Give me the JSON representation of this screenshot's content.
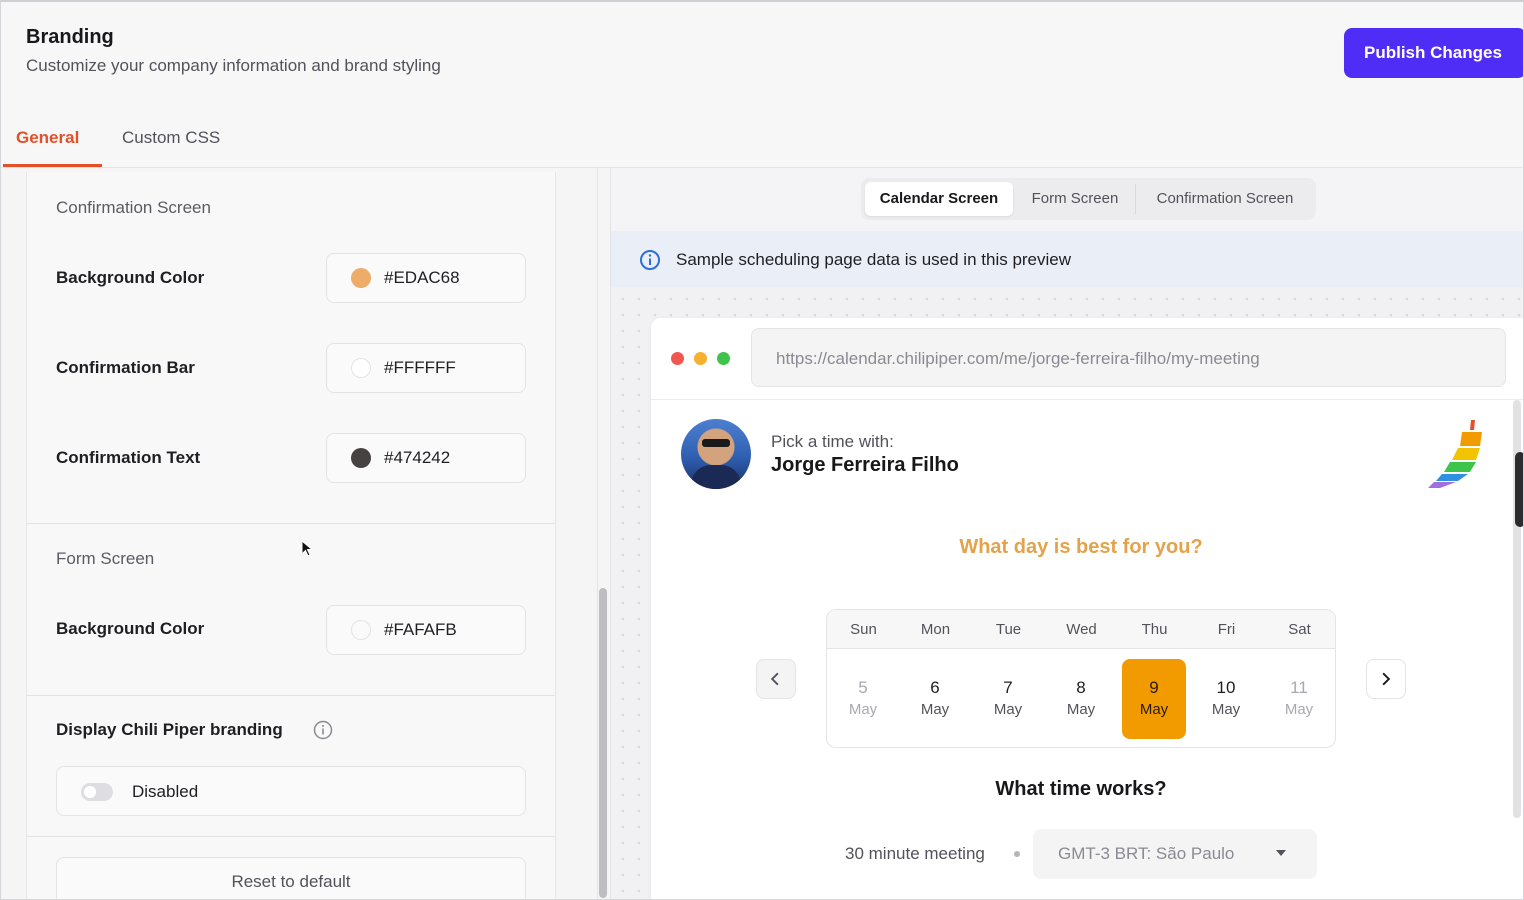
{
  "header": {
    "title": "Branding",
    "subtitle": "Customize your company information and brand styling",
    "publish_label": "Publish Changes"
  },
  "tabs": [
    {
      "label": "General",
      "active": true
    },
    {
      "label": "Custom CSS",
      "active": false
    }
  ],
  "confirmation_screen": {
    "title": "Confirmation Screen",
    "fields": [
      {
        "label": "Background Color",
        "value": "#EDAC68",
        "swatch": "#EDAC68"
      },
      {
        "label": "Confirmation Bar",
        "value": "#FFFFFF",
        "swatch": "#FFFFFF"
      },
      {
        "label": "Confirmation Text",
        "value": "#474242",
        "swatch": "#474242"
      }
    ]
  },
  "form_screen": {
    "title": "Form Screen",
    "fields": [
      {
        "label": "Background Color",
        "value": "#FAFAFB",
        "swatch": "#FAFAFB"
      }
    ]
  },
  "branding": {
    "label": "Display Chili Piper branding",
    "toggle_label": "Disabled",
    "enabled": false
  },
  "reset_label": "Reset to default",
  "preview": {
    "segments": [
      {
        "label": "Calendar Screen",
        "active": true
      },
      {
        "label": "Form Screen",
        "active": false
      },
      {
        "label": "Confirmation Screen",
        "active": false
      }
    ],
    "info_text": "Sample scheduling page data is used in this preview",
    "url": "https://calendar.chilipiper.com/me/jorge-ferreira-filho/my-meeting",
    "pick_label": "Pick a time with:",
    "host_name": "Jorge Ferreira Filho",
    "day_question": "What day is best for you?",
    "weekdays": [
      "Sun",
      "Mon",
      "Tue",
      "Wed",
      "Thu",
      "Fri",
      "Sat"
    ],
    "days": [
      {
        "num": "5",
        "month": "May",
        "state": "muted"
      },
      {
        "num": "6",
        "month": "May",
        "state": "normal"
      },
      {
        "num": "7",
        "month": "May",
        "state": "normal"
      },
      {
        "num": "8",
        "month": "May",
        "state": "normal"
      },
      {
        "num": "9",
        "month": "May",
        "state": "selected"
      },
      {
        "num": "10",
        "month": "May",
        "state": "normal"
      },
      {
        "num": "11",
        "month": "May",
        "state": "muted"
      }
    ],
    "time_question": "What time works?",
    "meeting_length": "30 minute meeting",
    "timezone": "GMT-3  BRT: São Paulo"
  },
  "colors": {
    "accent": "#4F2DF6",
    "tab_active": "#E4502A",
    "day_question": "#E4A24A",
    "selected_day": "#F29B00"
  }
}
